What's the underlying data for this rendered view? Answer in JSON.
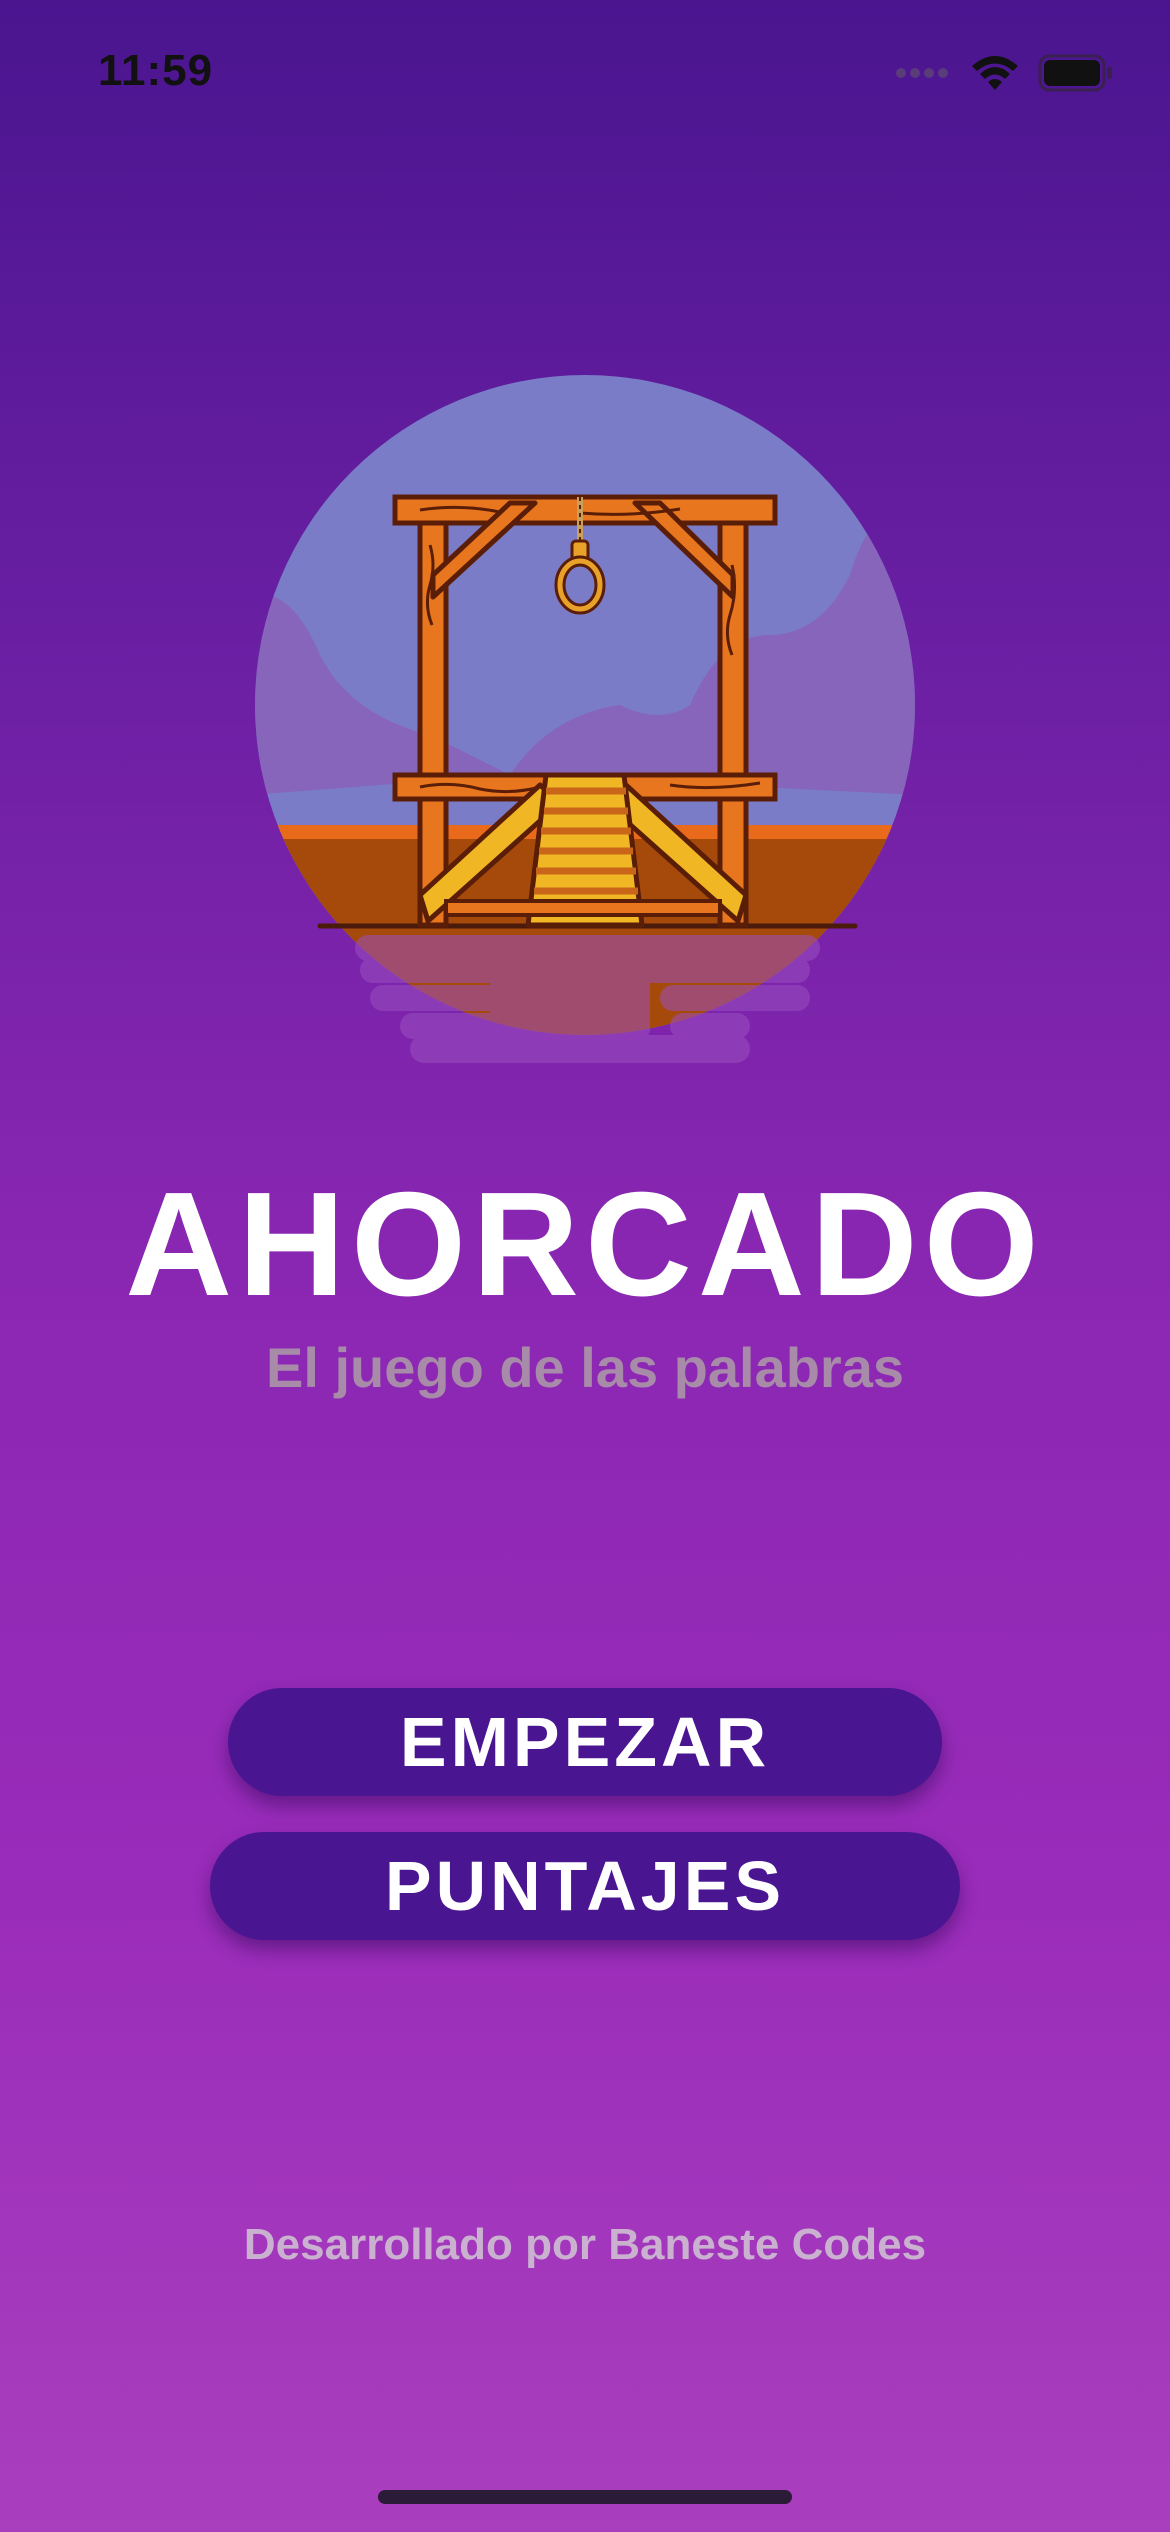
{
  "status_bar": {
    "time": "11:59",
    "icons": [
      "signal-dots-icon",
      "wifi-icon",
      "battery-icon"
    ]
  },
  "illustration": {
    "icon": "gallows-icon"
  },
  "title": "AHORCADO",
  "subtitle": "El juego de las palabras",
  "buttons": {
    "start": "EMPEZAR",
    "scores": "PUNTAJES"
  },
  "footer": "Desarrollado por Baneste Codes",
  "colors": {
    "background_top": "#4a158f",
    "background_bottom": "#a93fbd",
    "button": "#4a1591",
    "subtitle": "#a78ba8",
    "footer": "#c9b1cf"
  }
}
